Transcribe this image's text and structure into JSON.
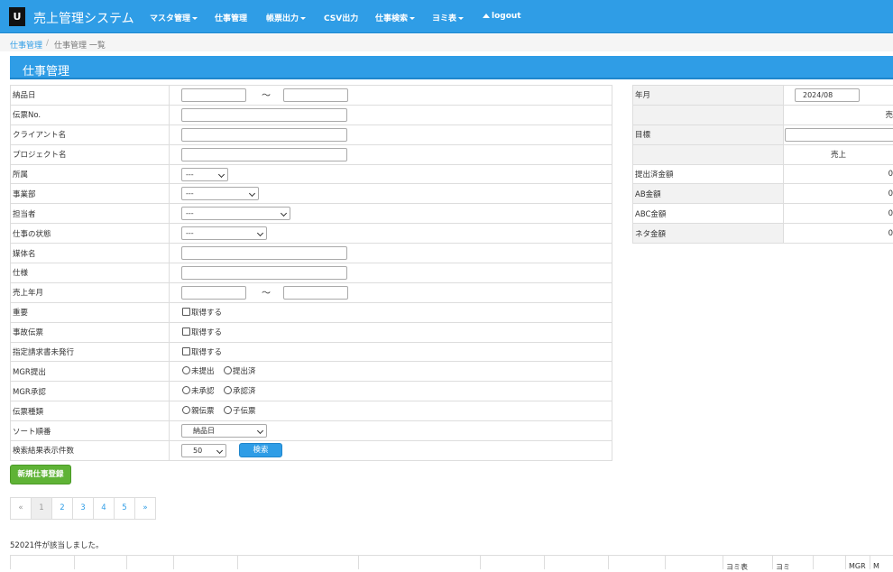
{
  "app": {
    "logo_letter": "U",
    "title": "売上管理システム"
  },
  "nav": {
    "items": [
      {
        "label": "マスタ管理",
        "dropdown": true
      },
      {
        "label": "仕事管理",
        "dropdown": false
      },
      {
        "label": "帳票出力",
        "dropdown": true
      },
      {
        "label": "CSV出力",
        "dropdown": false
      },
      {
        "label": "仕事検索",
        "dropdown": true
      },
      {
        "label": "ヨミ表",
        "dropdown": true
      }
    ],
    "logout": "logout"
  },
  "breadcrumb": {
    "link": "仕事管理",
    "separator": "/",
    "current": "仕事管理 一覧"
  },
  "page_title": "仕事管理",
  "search": {
    "labels": {
      "delivery_date": "納品日",
      "slip_no": "伝票No.",
      "client_name": "クライアント名",
      "project_name": "プロジェクト名",
      "affiliation": "所属",
      "division": "事業部",
      "person": "担当者",
      "status": "仕事の状態",
      "media": "媒体名",
      "spec": "仕様",
      "sales_month": "売上年月",
      "important": "重要",
      "accident": "事故伝票",
      "invoice": "指定請求書未発行",
      "mgr_submit": "MGR提出",
      "mgr_approve": "MGR承認",
      "slip_type": "伝票種類",
      "sort": "ソート順番",
      "per_page": "検索結果表示件数"
    },
    "range_separator": "～",
    "select_empty": "---",
    "checkbox_label": "取得する",
    "mgr_submit_options": [
      "未提出",
      "提出済"
    ],
    "mgr_approve_options": [
      "未承認",
      "承認済"
    ],
    "slip_type_options": [
      "親伝票",
      "子伝票"
    ],
    "sort_value": "納品日",
    "per_page_value": "50",
    "search_button": "検索"
  },
  "summary": {
    "year_month_label": "年月",
    "year_month_value": "2024/08",
    "sales_header_partial": "売",
    "target_label": "目標",
    "sales_col": "売上",
    "rows": [
      {
        "label": "提出済金額",
        "value": "0"
      },
      {
        "label": "AB金額",
        "value": "0"
      },
      {
        "label": "ABC金額",
        "value": "0"
      },
      {
        "label": "ネタ金額",
        "value": "0"
      }
    ]
  },
  "new_button": "新規仕事登録",
  "pagination": {
    "prev": "«",
    "pages": [
      "1",
      "2",
      "3",
      "4",
      "5"
    ],
    "next": "»"
  },
  "result_count": "52021件が該当しました。",
  "results_header": {
    "yomi_table": "ヨミ表",
    "yomi": "ヨミ",
    "mgr": "MGR",
    "mgr_partial": "M"
  },
  "colors": {
    "primary": "#2f9de6",
    "success": "#5fb336"
  }
}
